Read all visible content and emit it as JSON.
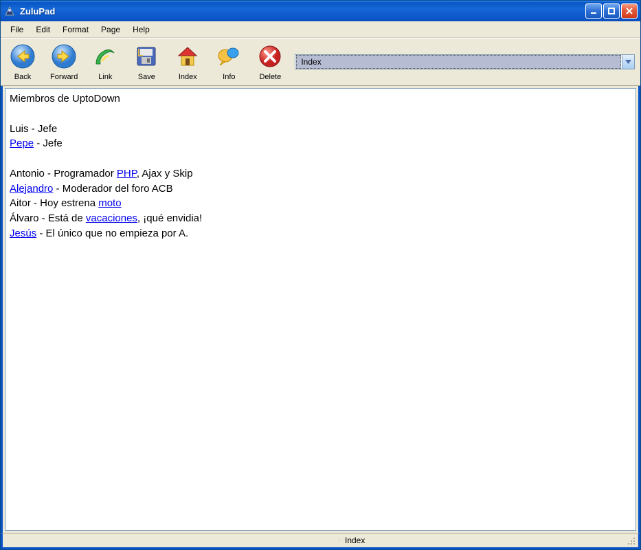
{
  "window": {
    "title": "ZuluPad"
  },
  "menu": {
    "items": [
      "File",
      "Edit",
      "Format",
      "Page",
      "Help"
    ]
  },
  "toolbar": {
    "back": {
      "label": "Back"
    },
    "forward": {
      "label": "Forward"
    },
    "link": {
      "label": "Link"
    },
    "save": {
      "label": "Save"
    },
    "index": {
      "label": "Index"
    },
    "info": {
      "label": "Info"
    },
    "delete": {
      "label": "Delete"
    },
    "combo": {
      "selected": "Index"
    }
  },
  "content": {
    "line1": "Miembros de UptoDown",
    "line3_pre": "Luis - Jefe",
    "line4_link": "Pepe",
    "line4_rest": " - Jefe",
    "line6_pre": "Antonio - Programador ",
    "line6_link": "PHP",
    "line6_rest": ", Ajax y Skip",
    "line7_link": "Alejandro",
    "line7_rest": " - Moderador del foro ACB",
    "line8_pre": "Aitor - Hoy estrena ",
    "line8_link": "moto",
    "line9_pre": "Álvaro - Está de ",
    "line9_link": "vacaciones",
    "line9_rest": ", ¡qué envidia!",
    "line10_link": "Jesús",
    "line10_rest": " - El único que no empieza por A."
  },
  "status": {
    "text": "Index"
  }
}
